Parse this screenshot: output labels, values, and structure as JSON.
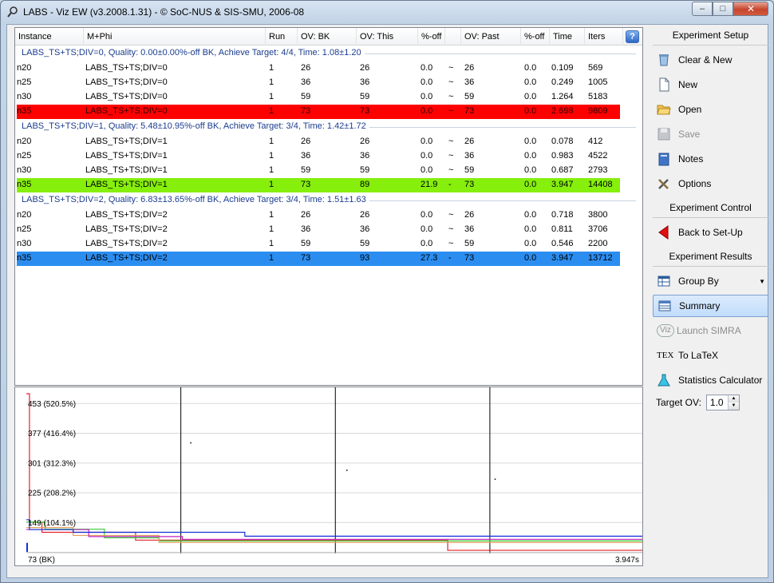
{
  "window": {
    "title": "LABS - Viz EW (v3.2008.1.31) - © SoC-NUS & SIS-SMU, 2006-08",
    "minimize_glyph": "–",
    "maximize_glyph": "□",
    "close_glyph": "✕"
  },
  "table": {
    "columns": [
      "Instance",
      "M+Phi",
      "Run",
      "OV: BK",
      "OV: This",
      "%-off",
      "",
      "OV: Past",
      "%-off",
      "Time",
      "Iters"
    ],
    "help_glyph": "?",
    "groups": [
      {
        "header": "LABS_TS+TS;DIV=0, Quality: 0.00±0.00%-off BK, Achieve Target: 4/4, Time: 1.08±1.20",
        "rows": [
          {
            "highlight": "",
            "cells": [
              "n20",
              "LABS_TS+TS;DIV=0",
              "1",
              "26",
              "26",
              "0.0",
              "~",
              "26",
              "0.0",
              "0.109",
              "569"
            ]
          },
          {
            "highlight": "",
            "cells": [
              "n25",
              "LABS_TS+TS;DIV=0",
              "1",
              "36",
              "36",
              "0.0",
              "~",
              "36",
              "0.0",
              "0.249",
              "1005"
            ]
          },
          {
            "highlight": "",
            "cells": [
              "n30",
              "LABS_TS+TS;DIV=0",
              "1",
              "59",
              "59",
              "0.0",
              "~",
              "59",
              "0.0",
              "1.264",
              "5183"
            ]
          },
          {
            "highlight": "red",
            "cells": [
              "n35",
              "LABS_TS+TS;DIV=0",
              "1",
              "73",
              "73",
              "0.0",
              "~",
              "73",
              "0.0",
              "2.698",
              "9809"
            ]
          }
        ]
      },
      {
        "header": "LABS_TS+TS;DIV=1, Quality: 5.48±10.95%-off BK, Achieve Target: 3/4, Time: 1.42±1.72",
        "rows": [
          {
            "highlight": "",
            "cells": [
              "n20",
              "LABS_TS+TS;DIV=1",
              "1",
              "26",
              "26",
              "0.0",
              "~",
              "26",
              "0.0",
              "0.078",
              "412"
            ]
          },
          {
            "highlight": "",
            "cells": [
              "n25",
              "LABS_TS+TS;DIV=1",
              "1",
              "36",
              "36",
              "0.0",
              "~",
              "36",
              "0.0",
              "0.983",
              "4522"
            ]
          },
          {
            "highlight": "",
            "cells": [
              "n30",
              "LABS_TS+TS;DIV=1",
              "1",
              "59",
              "59",
              "0.0",
              "~",
              "59",
              "0.0",
              "0.687",
              "2793"
            ]
          },
          {
            "highlight": "green",
            "cells": [
              "n35",
              "LABS_TS+TS;DIV=1",
              "1",
              "73",
              "89",
              "21.9",
              "-",
              "73",
              "0.0",
              "3.947",
              "14408"
            ]
          }
        ]
      },
      {
        "header": "LABS_TS+TS;DIV=2, Quality: 6.83±13.65%-off BK, Achieve Target: 3/4, Time: 1.51±1.63",
        "rows": [
          {
            "highlight": "",
            "cells": [
              "n20",
              "LABS_TS+TS;DIV=2",
              "1",
              "26",
              "26",
              "0.0",
              "~",
              "26",
              "0.0",
              "0.718",
              "3800"
            ]
          },
          {
            "highlight": "",
            "cells": [
              "n25",
              "LABS_TS+TS;DIV=2",
              "1",
              "36",
              "36",
              "0.0",
              "~",
              "36",
              "0.0",
              "0.811",
              "3706"
            ]
          },
          {
            "highlight": "",
            "cells": [
              "n30",
              "LABS_TS+TS;DIV=2",
              "1",
              "59",
              "59",
              "0.0",
              "~",
              "59",
              "0.0",
              "0.546",
              "2200"
            ]
          },
          {
            "highlight": "blue",
            "cells": [
              "n35",
              "LABS_TS+TS;DIV=2",
              "1",
              "73",
              "93",
              "27.3",
              "-",
              "73",
              "0.0",
              "3.947",
              "13712"
            ]
          }
        ]
      }
    ]
  },
  "colors": {
    "row_red": "#ff0000",
    "row_green": "#86ef0c",
    "row_blue": "#2b8df0",
    "group_header_text": "#1a3d8f",
    "series_red": "#e8202a",
    "series_green": "#3ecf3a",
    "series_blue": "#1230d8",
    "series_orange": "#e0a060",
    "series_magenta": "#c020c0"
  },
  "chart_data": {
    "type": "line",
    "title": "",
    "xlabel": "",
    "ylabel": "",
    "y_tick_labels": [
      "453 (520.5%)",
      "377 (416.4%)",
      "301 (312.3%)",
      "225 (208.2%)",
      "149 (104.1%)",
      "73 (BK)"
    ],
    "y_ticks": [
      453,
      377,
      301,
      225,
      149,
      73
    ],
    "ylim": [
      73,
      477
    ],
    "xlim": [
      0,
      3.947
    ],
    "x_end_label": "3.947s",
    "vertical_markers": [
      0.99,
      1.98,
      2.97
    ],
    "grid": true,
    "series": [
      {
        "color_key": "series_red",
        "points": [
          [
            0,
            477
          ],
          [
            0.02,
            149
          ],
          [
            0.1,
            123
          ],
          [
            0.7,
            103
          ],
          [
            2.6,
            103
          ],
          [
            2.7,
            77
          ],
          [
            3.947,
            77
          ]
        ]
      },
      {
        "color_key": "series_green",
        "points": [
          [
            0,
            149
          ],
          [
            0.12,
            131
          ],
          [
            0.5,
            109
          ],
          [
            0.85,
            101
          ],
          [
            3.947,
            101
          ]
        ]
      },
      {
        "color_key": "series_orange",
        "points": [
          [
            0,
            135
          ],
          [
            0.3,
            115
          ],
          [
            0.85,
            97
          ],
          [
            2.6,
            97
          ],
          [
            3.947,
            97
          ]
        ]
      },
      {
        "color_key": "series_magenta",
        "points": [
          [
            0,
            130
          ],
          [
            0.4,
            112
          ],
          [
            1.0,
            105
          ],
          [
            3.947,
            105
          ]
        ]
      },
      {
        "color_key": "series_blue",
        "points": [
          [
            0,
            155
          ],
          [
            0.02,
            130
          ],
          [
            0.3,
            123
          ],
          [
            1.4,
            113
          ],
          [
            3.947,
            113
          ]
        ]
      }
    ],
    "scatter_marks": [
      [
        1.05,
        353
      ],
      [
        2.05,
        283
      ],
      [
        3.0,
        260
      ]
    ]
  },
  "sidebar": {
    "setup_header": "Experiment Setup",
    "clear_new": "Clear & New",
    "new": "New",
    "open": "Open",
    "save": "Save",
    "notes": "Notes",
    "options": "Options",
    "control_header": "Experiment Control",
    "back_setup": "Back to Set-Up",
    "results_header": "Experiment Results",
    "group_by": "Group By",
    "summary": "Summary",
    "launch_simra": "Launch SIMRA",
    "to_latex": "To LaTeX",
    "stats_calc": "Statistics Calculator",
    "target_ov_label": "Target OV:",
    "target_ov_value": "1.0",
    "viz_glyph": "Viz",
    "tex_glyph": "TEX",
    "spin_up": "▲",
    "spin_down": "▼",
    "dropdown_glyph": "▼"
  }
}
